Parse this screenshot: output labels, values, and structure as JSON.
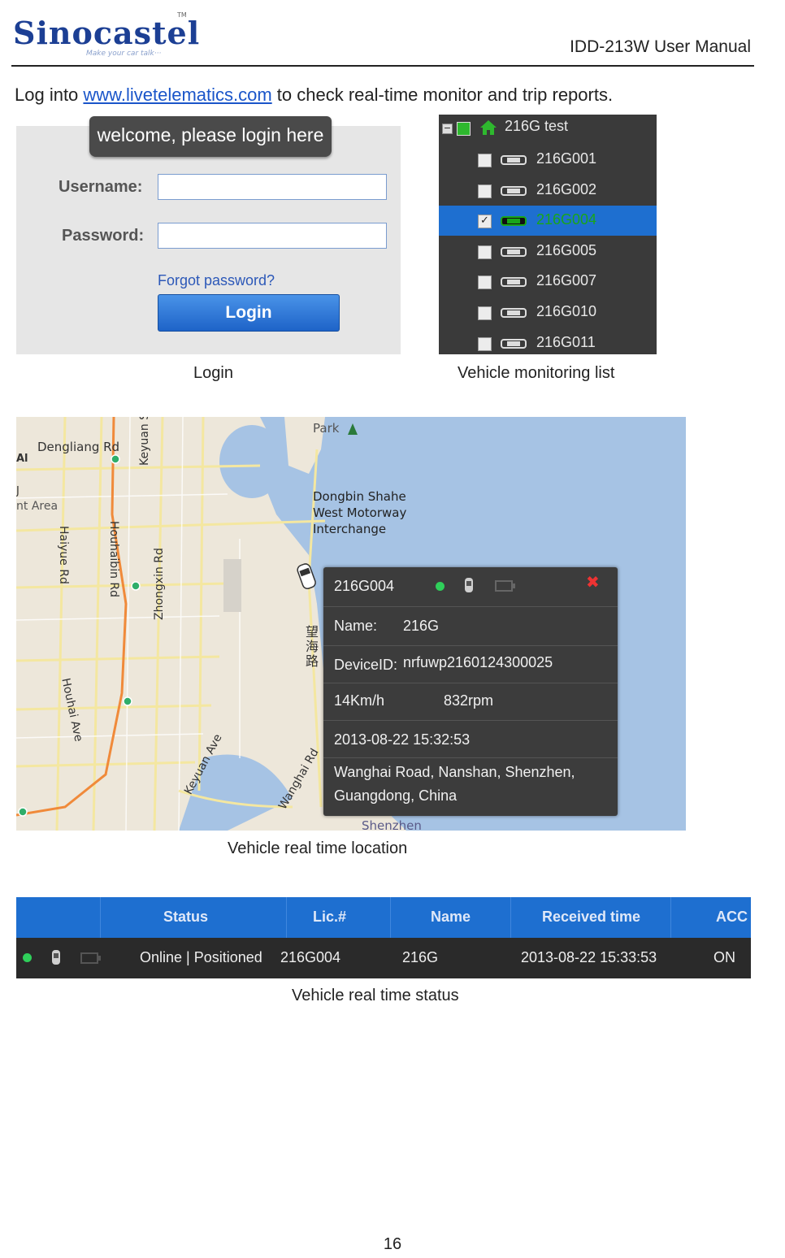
{
  "header": {
    "brand": "Sinocastel",
    "brand_tm": "TM",
    "brand_tagline": "Make your car talk···",
    "manual_title": "IDD-213W User Manual"
  },
  "intro": {
    "prefix": "Log into ",
    "link": "www.livetelematics.com",
    "suffix": " to check real-time monitor and trip reports."
  },
  "login": {
    "tab_title": "welcome, please login here",
    "username_label": "Username:",
    "password_label": "Password:",
    "username_value": "",
    "password_value": "",
    "forgot": "Forgot password?",
    "button": "Login",
    "caption": "Login"
  },
  "vehicle_list": {
    "root": "216G test",
    "items": [
      {
        "id": "216G001",
        "checked": false,
        "selected": false
      },
      {
        "id": "216G002",
        "checked": false,
        "selected": false
      },
      {
        "id": "216G004",
        "checked": true,
        "selected": true
      },
      {
        "id": "216G005",
        "checked": false,
        "selected": false
      },
      {
        "id": "216G007",
        "checked": false,
        "selected": false
      },
      {
        "id": "216G010",
        "checked": false,
        "selected": false
      },
      {
        "id": "216G011",
        "checked": false,
        "selected": false
      }
    ],
    "caption": "Vehicle monitoring list",
    "colors": {
      "panel": "#3a3a3a",
      "selected": "#1e6fd0",
      "online": "#19a619"
    }
  },
  "map": {
    "labels": {
      "park": "Park",
      "dengliang": "Dengliang Rd",
      "al": "Al",
      "j": "J",
      "area": "nt Area",
      "keyuan_south": "Keyuan South Rd",
      "interchange_1": "Dongbin Shahe",
      "interchange_2": "West Motorway",
      "interchange_3": "Interchange",
      "haiyue": "Haiyue Rd",
      "houhaibin": "Houhaibin Rd",
      "zhongxin": "Zhongxin Rd",
      "houhai_ave": "Houhai Ave",
      "keyuan_ave": "Keyuan Ave",
      "wanghai_cn": "望海路",
      "wanghai_rd": "Wanghai Rd",
      "shenzhen": "Shenzhen"
    },
    "popup": {
      "vehicle_id": "216G004",
      "name_label": "Name:",
      "name_value": "216G",
      "device_label": "DeviceID:",
      "device_value": "nrfuwp2160124300025",
      "speed": "14Km/h",
      "rpm": "832rpm",
      "time": "2013-08-22 15:32:53",
      "address_line1": "Wanghai Road, Nanshan, Shenzhen,",
      "address_line2": "Guangdong, China"
    },
    "caption": "Vehicle real time location"
  },
  "status_table": {
    "headers": [
      "Status",
      "Lic.#",
      "Name",
      "Received time",
      "ACC"
    ],
    "row": {
      "status": "Online | Positioned",
      "lic": "216G004",
      "name": "216G",
      "received_time": "2013-08-22 15:33:53",
      "acc": "ON"
    },
    "caption": "Vehicle real time status"
  },
  "page_number": "16"
}
